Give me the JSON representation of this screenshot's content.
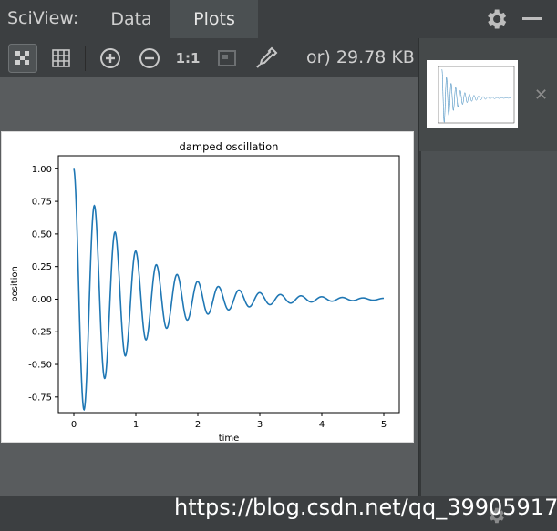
{
  "app": {
    "title": "SciView:"
  },
  "tabs": [
    {
      "label": "Data"
    },
    {
      "label": "Plots"
    }
  ],
  "toolbar": {
    "actual_size_label": "1:1",
    "file_info": "or) 29.78 KB"
  },
  "icons": {
    "settings": "gear-icon",
    "minimize": "minimize-icon",
    "transparent_bg": "checkerboard-icon",
    "grid": "grid-icon",
    "zoom_in": "zoom-in-icon",
    "zoom_out": "zoom-out-icon",
    "fit": "fit-zoom-icon",
    "color_picker": "eyedropper-icon",
    "close": "close-icon"
  },
  "colors": {
    "accent_series": "#1f77b4",
    "background": "#3c3f41",
    "plot_area": "#595c5e"
  },
  "watermark": "https://blog.csdn.net/qq_39905917",
  "chart_data": {
    "type": "line",
    "title": "damped oscillation",
    "xlabel": "time",
    "ylabel": "position",
    "xlim": [
      -0.25,
      5.25
    ],
    "ylim": [
      -0.87,
      1.1
    ],
    "xticks": [
      "0",
      "1",
      "2",
      "3",
      "4",
      "5"
    ],
    "yticks": [
      "1.00",
      "0.75",
      "0.50",
      "0.25",
      "0.00",
      "-0.25",
      "-0.50",
      "-0.75"
    ],
    "series": [
      {
        "function": "exp(-t) * cos(2*pi*3*t)",
        "x_start": 0,
        "x_end": 5,
        "extrema": [
          [
            0,
            1.0
          ],
          [
            0.17,
            -0.85
          ],
          [
            0.33,
            0.72
          ],
          [
            0.5,
            -0.61
          ],
          [
            0.67,
            0.51
          ],
          [
            0.83,
            -0.44
          ],
          [
            1.0,
            0.37
          ],
          [
            1.5,
            -0.22
          ],
          [
            2.0,
            0.14
          ],
          [
            3.0,
            0.05
          ],
          [
            4.0,
            0.02
          ],
          [
            5.0,
            0.01
          ]
        ]
      }
    ],
    "grid": false
  }
}
